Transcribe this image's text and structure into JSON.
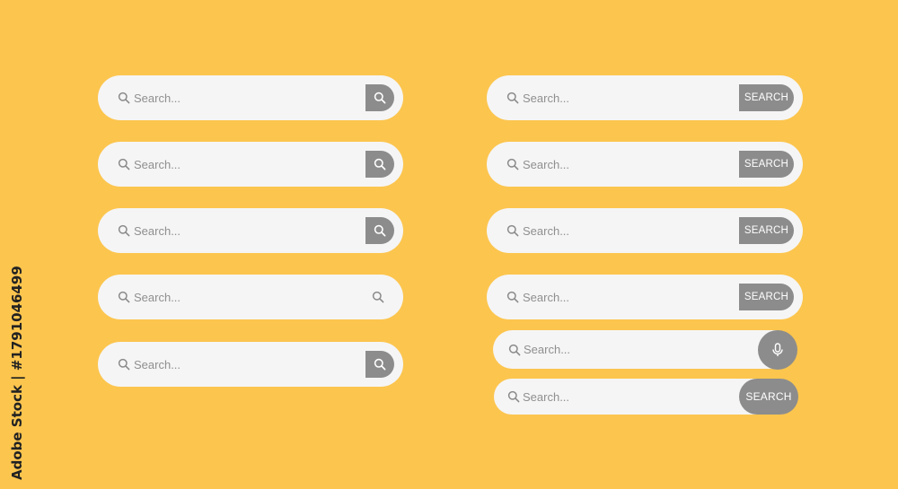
{
  "search": {
    "placeholder": "Search..."
  },
  "search_button_label": "SEARCH",
  "watermark": "Adobe Stock | #1791046499",
  "colors": {
    "background": "#fcc54e",
    "field": "#f5f5f5",
    "button": "#8c8c8c",
    "icon": "#8a8a8a"
  },
  "icons": {
    "field_icon": "search-icon",
    "button_icon": "search-icon",
    "voice_icon": "microphone-icon"
  }
}
